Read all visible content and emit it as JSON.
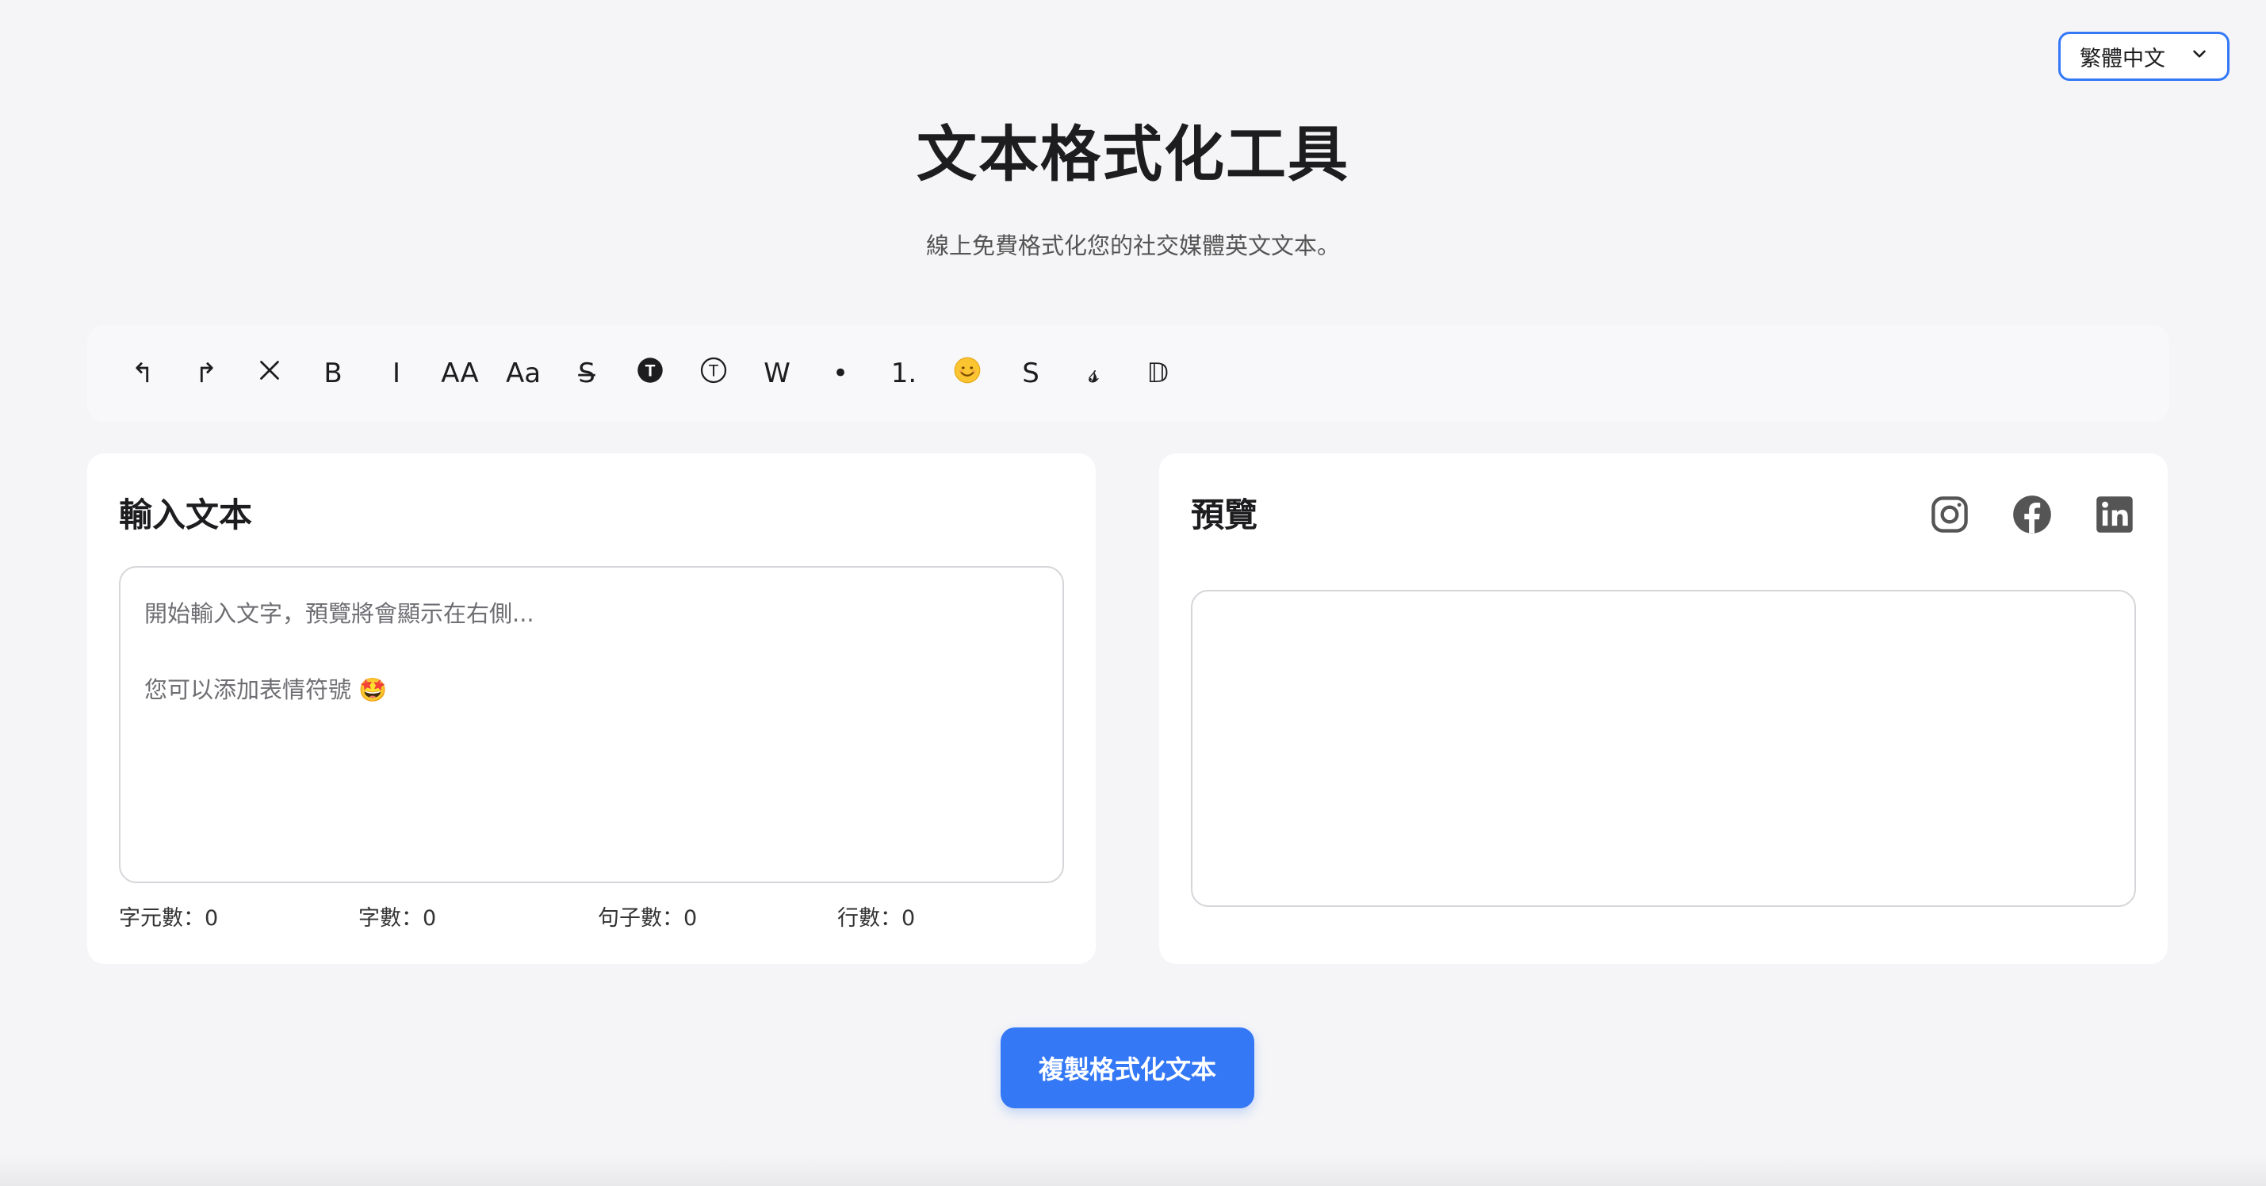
{
  "language_select": {
    "selected": "繁體中文",
    "icon": "chevron-down-icon"
  },
  "header": {
    "title": "文本格式化工具",
    "subtitle": "線上免費格式化您的社交媒體英文文本。"
  },
  "toolbar": {
    "undo": "↰",
    "redo": "↱",
    "clear": "✕",
    "bold": "B",
    "italic": "I",
    "uppercase": "AA",
    "capitalize": "Aa",
    "strikethrough": "S̶",
    "circled_filled": "🅣",
    "circled": "Ⓣ",
    "wide": "W",
    "bullet": "•",
    "numbered": "1.",
    "emoji": "😊",
    "sans": "S",
    "script": "𝓼",
    "double_struck": "𝔻"
  },
  "input_panel": {
    "title": "輸入文本",
    "placeholder": "開始輸入文字，預覽將會顯示在右側...\n\n您可以添加表情符號 🤩",
    "value": "",
    "stats": {
      "chars": "字元數：0",
      "words": "字數：0",
      "sentences": "句子數：0",
      "lines": "行數：0"
    }
  },
  "preview_panel": {
    "title": "預覽",
    "social_icons": [
      "instagram-icon",
      "facebook-icon",
      "linkedin-icon"
    ]
  },
  "copy_button": {
    "label": "複製格式化文本",
    "color": "#3478f6"
  }
}
